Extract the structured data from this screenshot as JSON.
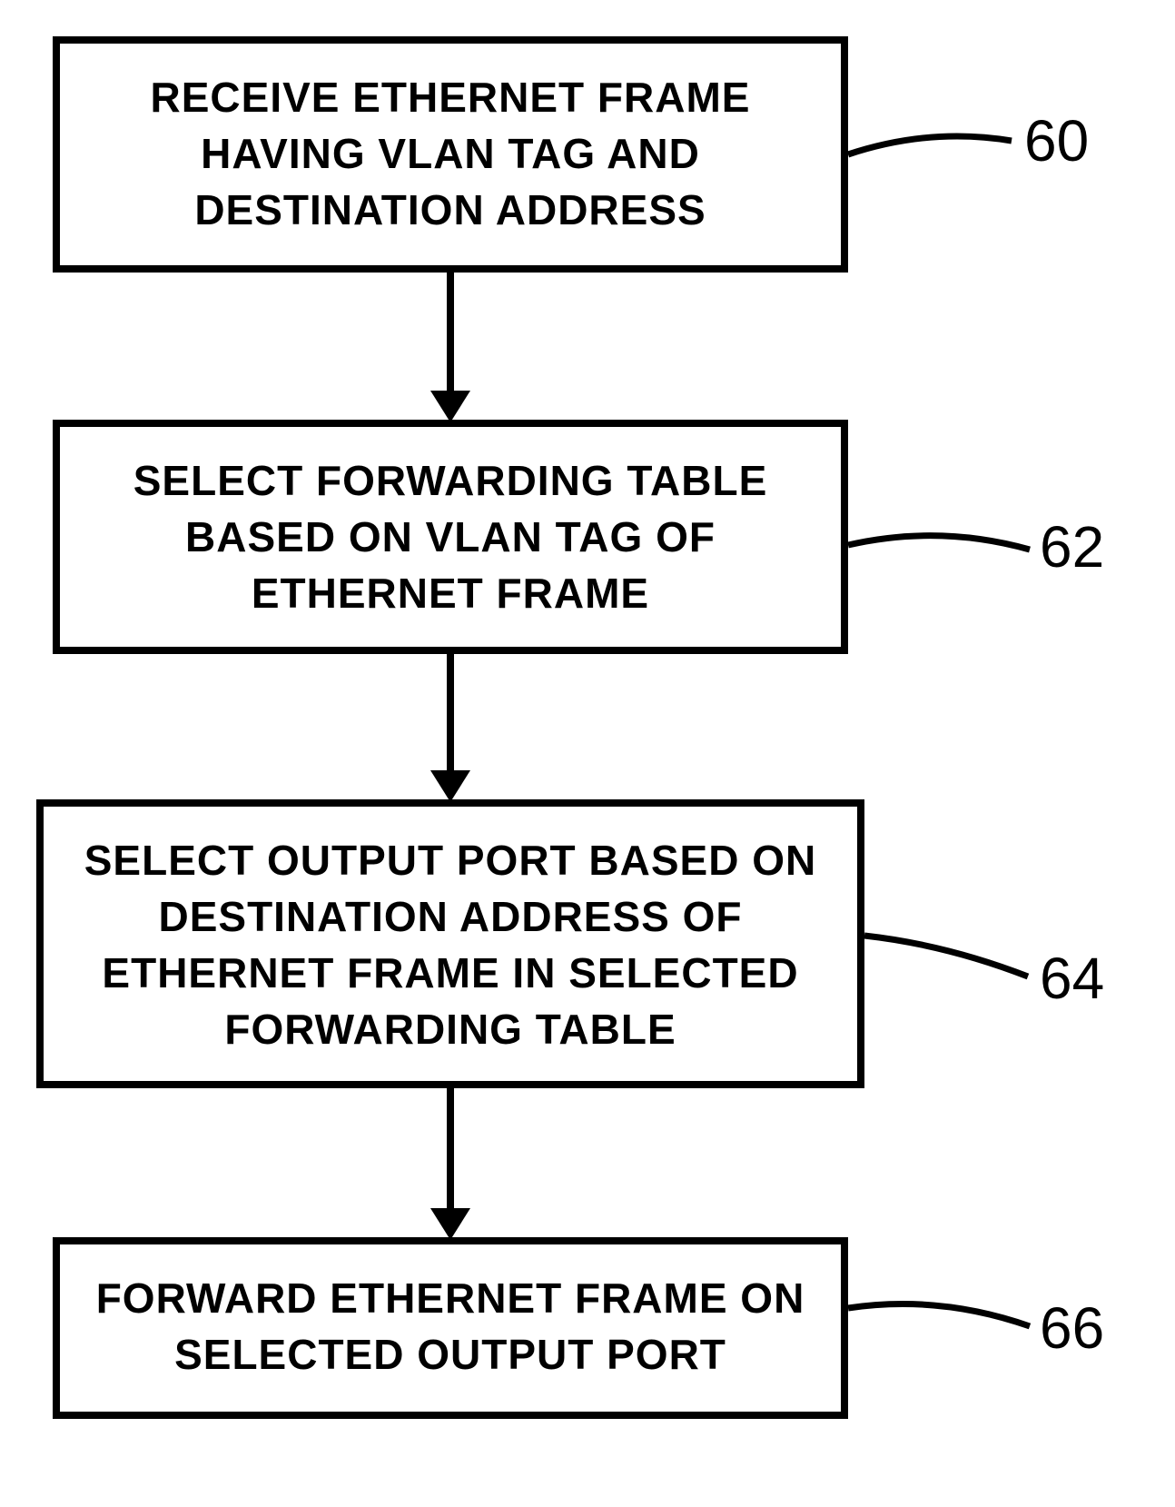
{
  "flowchart": {
    "steps": [
      {
        "text": "RECEIVE ETHERNET FRAME HAVING VLAN TAG AND DESTINATION ADDRESS",
        "ref": "60"
      },
      {
        "text": "SELECT FORWARDING TABLE BASED ON VLAN TAG OF ETHERNET FRAME",
        "ref": "62"
      },
      {
        "text": "SELECT OUTPUT PORT BASED ON DESTINATION ADDRESS OF ETHERNET FRAME IN SELECTED FORWARDING TABLE",
        "ref": "64"
      },
      {
        "text": "FORWARD ETHERNET FRAME ON SELECTED OUTPUT PORT",
        "ref": "66"
      }
    ]
  }
}
